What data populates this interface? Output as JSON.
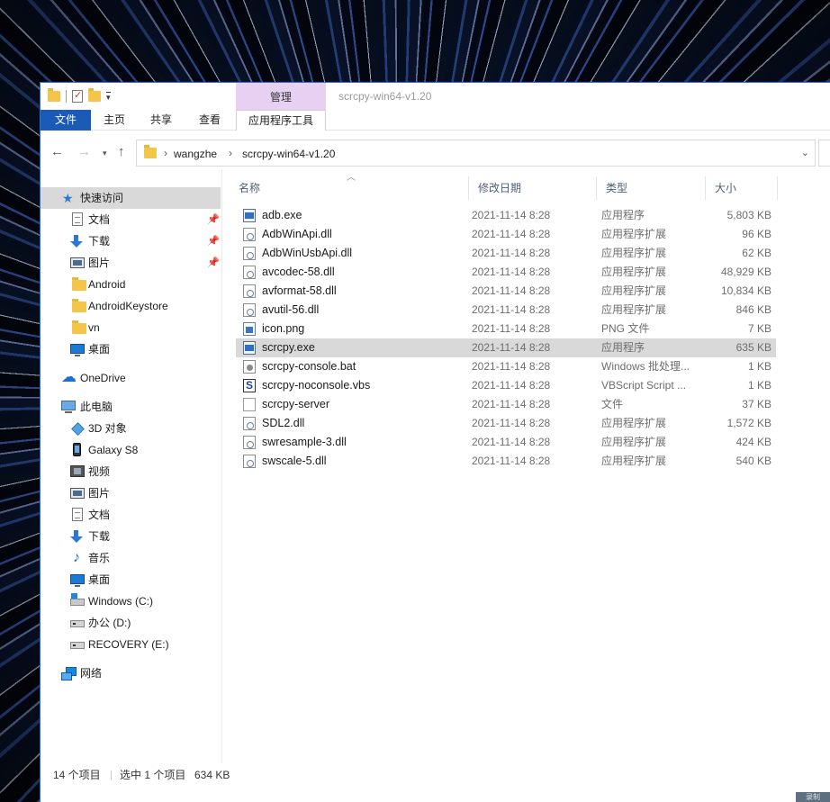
{
  "window": {
    "title": "scrcpy-win64-v1.20",
    "context_tab": "管理"
  },
  "ribbon": {
    "tabs": [
      "文件",
      "主页",
      "共享",
      "查看"
    ],
    "context_tool_tab": "应用程序工具"
  },
  "address": {
    "crumbs": [
      "wangzhe",
      "scrcpy-win64-v1.20"
    ]
  },
  "nav": {
    "quick_access": "快速访问",
    "pinned": [
      "文档",
      "下载",
      "图片"
    ],
    "recent_folders": [
      "Android",
      "AndroidKeystore",
      "vn"
    ],
    "desktop_qa": "桌面",
    "onedrive": "OneDrive",
    "this_pc": "此电脑",
    "pc_items": [
      "3D 对象",
      "Galaxy S8",
      "视频",
      "图片",
      "文档",
      "下载",
      "音乐",
      "桌面"
    ],
    "drives": [
      "Windows (C:)",
      "办公 (D:)",
      "RECOVERY (E:)"
    ],
    "network": "网络"
  },
  "columns": {
    "name": "名称",
    "date": "修改日期",
    "type": "类型",
    "size": "大小"
  },
  "files": [
    {
      "name": "adb.exe",
      "date": "2021-11-14 8:28",
      "type": "应用程序",
      "size": "5,803 KB",
      "icon": "exe-icon"
    },
    {
      "name": "AdbWinApi.dll",
      "date": "2021-11-14 8:28",
      "type": "应用程序扩展",
      "size": "96 KB",
      "icon": "dll-icon"
    },
    {
      "name": "AdbWinUsbApi.dll",
      "date": "2021-11-14 8:28",
      "type": "应用程序扩展",
      "size": "62 KB",
      "icon": "dll-icon"
    },
    {
      "name": "avcodec-58.dll",
      "date": "2021-11-14 8:28",
      "type": "应用程序扩展",
      "size": "48,929 KB",
      "icon": "dll-icon"
    },
    {
      "name": "avformat-58.dll",
      "date": "2021-11-14 8:28",
      "type": "应用程序扩展",
      "size": "10,834 KB",
      "icon": "dll-icon"
    },
    {
      "name": "avutil-56.dll",
      "date": "2021-11-14 8:28",
      "type": "应用程序扩展",
      "size": "846 KB",
      "icon": "dll-icon"
    },
    {
      "name": "icon.png",
      "date": "2021-11-14 8:28",
      "type": "PNG 文件",
      "size": "7 KB",
      "icon": "png-icon"
    },
    {
      "name": "scrcpy.exe",
      "date": "2021-11-14 8:28",
      "type": "应用程序",
      "size": "635 KB",
      "icon": "exe-icon"
    },
    {
      "name": "scrcpy-console.bat",
      "date": "2021-11-14 8:28",
      "type": "Windows 批处理...",
      "size": "1 KB",
      "icon": "bat-icon"
    },
    {
      "name": "scrcpy-noconsole.vbs",
      "date": "2021-11-14 8:28",
      "type": "VBScript Script ...",
      "size": "1 KB",
      "icon": "vbs-icon"
    },
    {
      "name": "scrcpy-server",
      "date": "2021-11-14 8:28",
      "type": "文件",
      "size": "37 KB",
      "icon": "file-icon"
    },
    {
      "name": "SDL2.dll",
      "date": "2021-11-14 8:28",
      "type": "应用程序扩展",
      "size": "1,572 KB",
      "icon": "dll-icon"
    },
    {
      "name": "swresample-3.dll",
      "date": "2021-11-14 8:28",
      "type": "应用程序扩展",
      "size": "424 KB",
      "icon": "dll-icon"
    },
    {
      "name": "swscale-5.dll",
      "date": "2021-11-14 8:28",
      "type": "应用程序扩展",
      "size": "540 KB",
      "icon": "dll-icon"
    }
  ],
  "status": {
    "count": "14 个项目",
    "selected": "选中 1 个项目",
    "selected_size": "634 KB",
    "corner": "录制"
  },
  "colors": {
    "file_tab": "#1a5bb8",
    "manage_tab": "#e8d0f3",
    "selection": "#d9d9d9",
    "column_header_text": "#4c607a"
  }
}
